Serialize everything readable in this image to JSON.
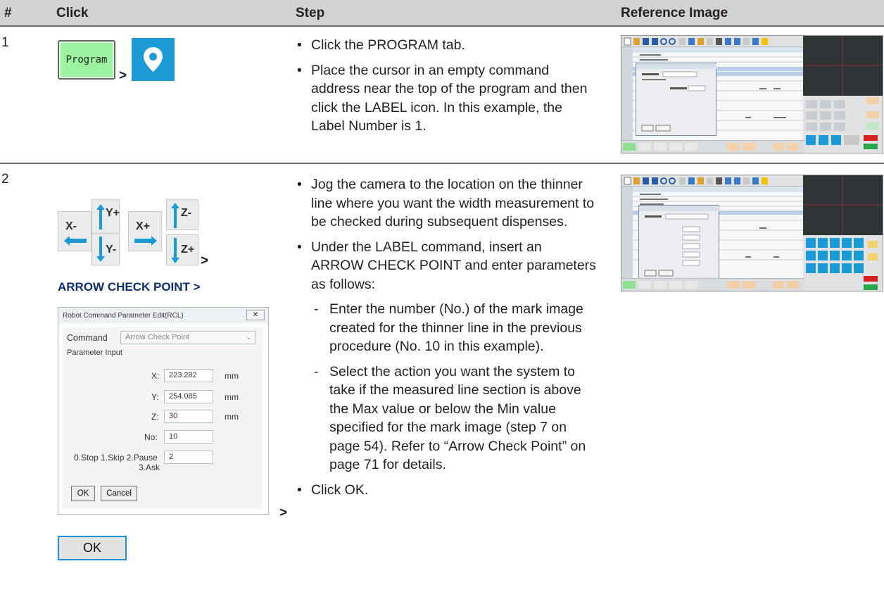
{
  "header": {
    "num": "#",
    "click": "Click",
    "step": "Step",
    "reference": "Reference Image"
  },
  "rows": [
    {
      "num": "1",
      "program_button": "Program",
      "gt": ">",
      "steps": [
        "Click the PROGRAM tab.",
        "Place the cursor in an empty command address near the top of the program and then click the LABEL icon. In this example, the Label Number is 1."
      ]
    },
    {
      "num": "2",
      "jog_labels": [
        "X-",
        "Y+",
        "Y-",
        "X+",
        "Z-",
        "Z+"
      ],
      "gt": ">",
      "arrow_check_label": "ARROW CHECK POINT >",
      "steps": [
        "Jog the camera to the location on the thinner line where you want the width measurement to be checked during subsequent dispenses.",
        "Under the LABEL command, insert an ARROW CHECK POINT and enter parameters as follows:",
        "Enter the number (No.) of the mark image created for the thinner line in the previous procedure (No. 10 in this example).",
        "Select the action you want the system to take if the measured line section is above the Max value or below the Min value specified for the mark image (step 7 on page 54). Refer to “Arrow Check Point” on page 71 for details.",
        "Click OK."
      ],
      "ok_button": "OK"
    }
  ],
  "dialog": {
    "title": "Robot Command Parameter Edit(RCL)",
    "close": "✕",
    "command_label": "Command",
    "command_value": "Arrow Check Point",
    "parameter_input": "Parameter Input",
    "x_label": "X:",
    "x_value": "223.282",
    "x_unit": "mm",
    "y_label": "Y:",
    "y_value": "254.085",
    "y_unit": "mm",
    "z_label": "Z:",
    "z_value": "30",
    "z_unit": "mm",
    "no_label": "No:",
    "no_value": "10",
    "action_label_1": "0.Stop 1.Skip 2.Pause",
    "action_label_2": "3.Ask",
    "action_value": "2",
    "ok": "OK",
    "cancel": "Cancel"
  },
  "colors": {
    "header_bg": "#d0d2d3",
    "rule": "#6d6e70",
    "program_green": "#9cf2a0",
    "label_blue": "#1b9ad6",
    "arrow_blue": "#1b9ad6"
  }
}
